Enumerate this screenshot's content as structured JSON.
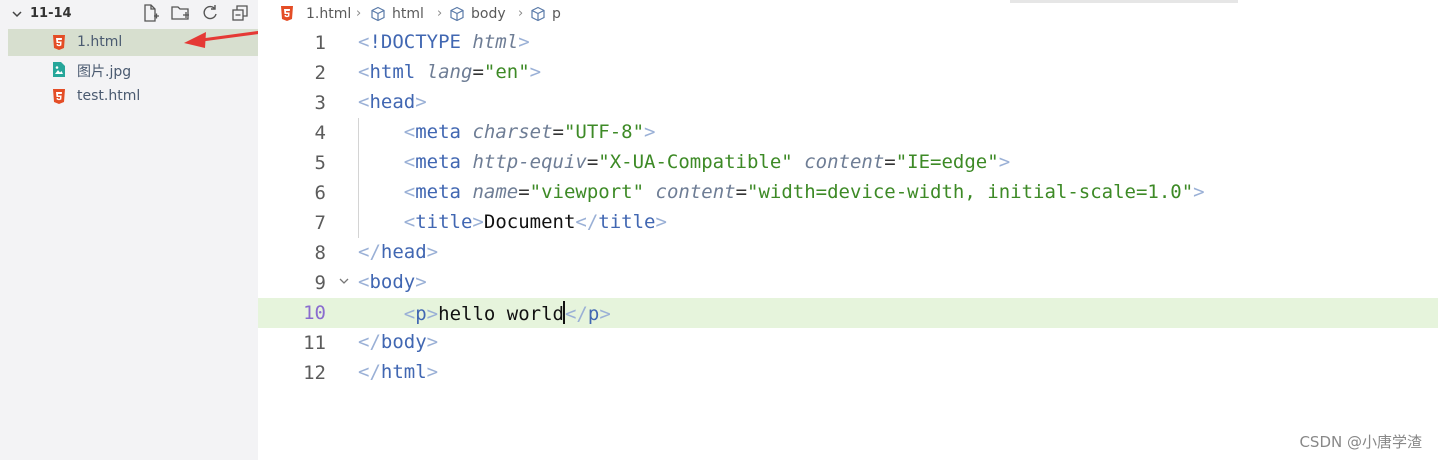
{
  "sidebar": {
    "folder": "11-14",
    "actions": [
      {
        "name": "new-file-icon",
        "label": "New File"
      },
      {
        "name": "new-folder-icon",
        "label": "New Folder"
      },
      {
        "name": "refresh-icon",
        "label": "Refresh"
      },
      {
        "name": "collapse-all-icon",
        "label": "Collapse"
      }
    ],
    "files": [
      {
        "name": "1.html",
        "icon": "html5-icon",
        "selected": true
      },
      {
        "name": "图片.jpg",
        "icon": "image-icon",
        "selected": false
      },
      {
        "name": "test.html",
        "icon": "html5-icon",
        "selected": false
      }
    ]
  },
  "breadcrumb": [
    "1.html",
    "html",
    "body",
    "p"
  ],
  "editor": {
    "current_line": 10,
    "line_numbers": [
      "1",
      "2",
      "3",
      "4",
      "5",
      "6",
      "7",
      "8",
      "9",
      "10",
      "11",
      "12"
    ]
  },
  "watermark": "CSDN @小唐学渣",
  "colors": {
    "tag": "#4167b2",
    "bracket": "#9ab0d6",
    "attr": "#6e7d95",
    "value": "#3d8a26",
    "current_line": "#e6f4dc",
    "selected_file": "#d7dfcf"
  }
}
